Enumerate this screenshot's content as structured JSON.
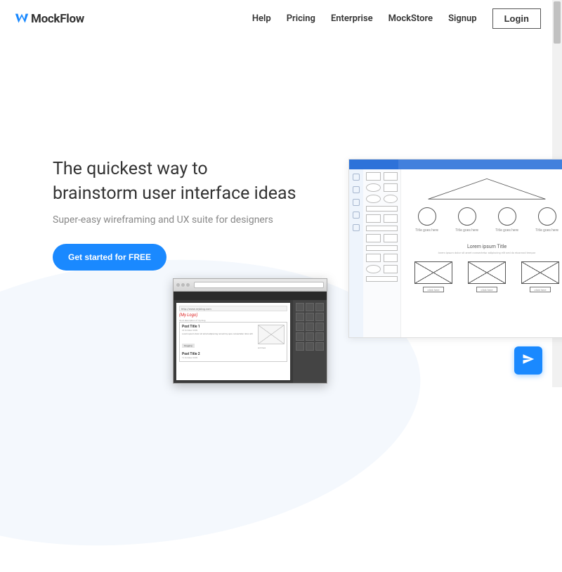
{
  "brand": "MockFlow",
  "nav": {
    "help": "Help",
    "pricing": "Pricing",
    "enterprise": "Enterprise",
    "mockstore": "MockStore",
    "signup": "Signup",
    "login": "Login"
  },
  "hero": {
    "title_line1": "The quickest way to",
    "title_line2": "brainstorm user interface ideas",
    "subtitle": "Super-easy wireframing and UX suite for designers",
    "cta": "Get started for FREE"
  },
  "mock_wireframe": {
    "circle_label": "Title goes here",
    "lorem_title": "Lorem ipsum Title",
    "lorem_sub": "lorem ipsum dolor sit amet consectetur adipiscing elit sed do eiusmod tempor",
    "card_label": "click here"
  },
  "mock_browser": {
    "url_hint": "http://www.myblog.com",
    "logo_text": "(My Logo)",
    "desc": "short description of my blog",
    "post_title_1": "Post Title 1",
    "post_date_1": "24 October 2009",
    "post_body_1": "Lorem ipsum dolor sit amet adipiscing nonummy quis consectetur dolor elit",
    "tag": "blogging",
    "post_title_2": "Post Title 2",
    "post_date_2": "12 October 2009"
  }
}
